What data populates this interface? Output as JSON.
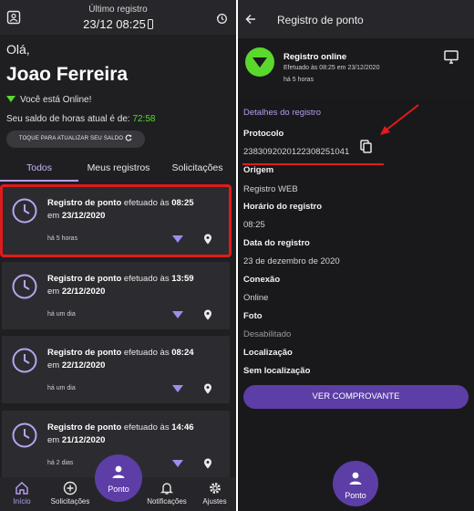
{
  "left": {
    "topbar": {
      "title": "Último registro",
      "datetime": "23/12 08:25"
    },
    "greeting": "Olá,",
    "user_name": "Joao Ferreira",
    "online_status": "Você está Online!",
    "balance_label": "Seu saldo de horas atual é de:",
    "balance_value": "72:58",
    "refresh_button": "TOQUE PARA ATUALIZAR SEU SALDO",
    "tabs": [
      "Todos",
      "Meus registros",
      "Solicitações"
    ],
    "records": [
      {
        "prefix": "Registro de ponto",
        "middle": "efetuado às",
        "time": "08:25",
        "em": "em",
        "date": "23/12/2020",
        "ago": "há 5 horas"
      },
      {
        "prefix": "Registro de ponto",
        "middle": "efetuado às",
        "time": "13:59",
        "em": "em",
        "date": "22/12/2020",
        "ago": "há um dia"
      },
      {
        "prefix": "Registro de ponto",
        "middle": "efetuado às",
        "time": "08:24",
        "em": "em",
        "date": "22/12/2020",
        "ago": "há um dia"
      },
      {
        "prefix": "Registro de ponto",
        "middle": "efetuado às",
        "time": "14:46",
        "em": "em",
        "date": "21/12/2020",
        "ago": "há 2 dias"
      }
    ],
    "nav": {
      "home": "Início",
      "requests": "Solicitações",
      "fab": "Ponto",
      "notifications": "Notificações",
      "settings": "Ajustes"
    }
  },
  "right": {
    "title": "Registro de ponto",
    "status": {
      "title": "Registro online",
      "subtitle": "Efetuado às 08:25 em 23/12/2020",
      "ago": "há 5 horas"
    },
    "details_heading": "Detalhes do registro",
    "fields": {
      "protocol_label": "Protocolo",
      "protocol_value": "23830920201223082510​41",
      "origin_label": "Origem",
      "origin_value": "Registro WEB",
      "time_label": "Horário do registro",
      "time_value": "08:25",
      "date_label": "Data do registro",
      "date_value": "23 de dezembro de 2020",
      "connection_label": "Conexão",
      "connection_value": "Online",
      "photo_label": "Foto",
      "photo_value": "Desabilitado",
      "location_label": "Localização",
      "location_value": "Sem localização"
    },
    "button": "VER COMPROVANTE",
    "fab": "Ponto"
  },
  "colors": {
    "accent_purple": "#5c3ea6",
    "online_green": "#5bd82d",
    "highlight_red": "#e01b1b",
    "tab_active": "#b89ef0"
  }
}
